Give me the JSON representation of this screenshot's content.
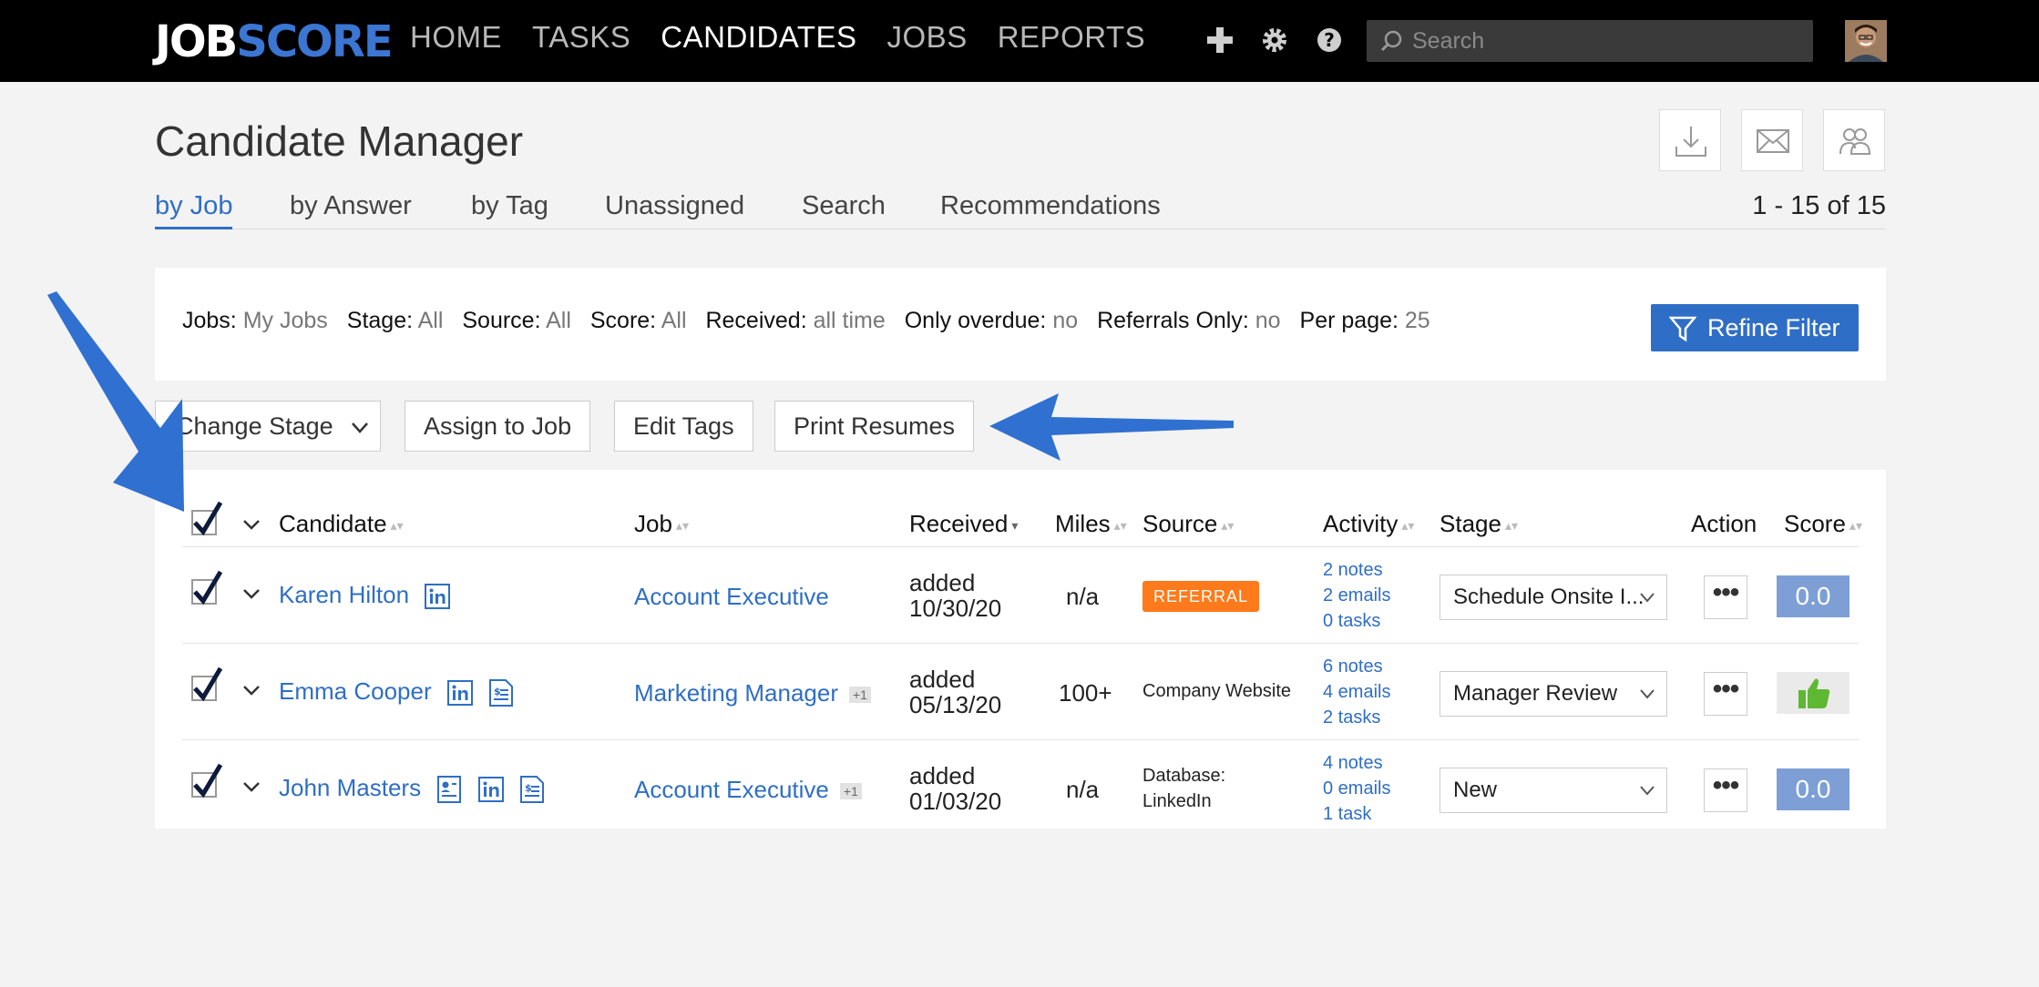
{
  "logo": {
    "part1": "JOB",
    "part2": "SCORE"
  },
  "nav": {
    "items": [
      {
        "label": "HOME",
        "active": false
      },
      {
        "label": "TASKS",
        "active": false
      },
      {
        "label": "CANDIDATES",
        "active": true
      },
      {
        "label": "JOBS",
        "active": false
      },
      {
        "label": "REPORTS",
        "active": false
      }
    ]
  },
  "topbar": {
    "search_placeholder": "Search",
    "icons": [
      "plus-icon",
      "gear-icon",
      "help-icon",
      "search-icon"
    ]
  },
  "page": {
    "title": "Candidate Manager",
    "count": "1 - 15 of 15",
    "header_icons": [
      "download-icon",
      "email-icon",
      "users-icon"
    ]
  },
  "tabs": [
    {
      "label": "by Job",
      "active": true
    },
    {
      "label": "by Answer",
      "active": false
    },
    {
      "label": "by Tag",
      "active": false
    },
    {
      "label": "Unassigned",
      "active": false
    },
    {
      "label": "Search",
      "active": false
    },
    {
      "label": "Recommendations",
      "active": false
    }
  ],
  "filters": [
    {
      "key": "Jobs:",
      "value": "My Jobs"
    },
    {
      "key": "Stage:",
      "value": "All"
    },
    {
      "key": "Source:",
      "value": "All"
    },
    {
      "key": "Score:",
      "value": "All"
    },
    {
      "key": "Received:",
      "value": "all time"
    },
    {
      "key": "Only overdue:",
      "value": "no"
    },
    {
      "key": "Referrals Only:",
      "value": "no"
    },
    {
      "key": "Per page:",
      "value": "25"
    }
  ],
  "refine_label": "Refine Filter",
  "actions": {
    "change_stage": "Change Stage",
    "assign_job": "Assign to Job",
    "edit_tags": "Edit Tags",
    "print_resumes": "Print Resumes"
  },
  "table": {
    "headers": {
      "candidate": "Candidate",
      "job": "Job",
      "received": "Received",
      "miles": "Miles",
      "source": "Source",
      "activity": "Activity",
      "stage": "Stage",
      "action": "Action",
      "score": "Score"
    },
    "rows": [
      {
        "name": "Karen Hilton",
        "icons": [
          "linkedin-icon"
        ],
        "job": "Account Executive",
        "job_extra": "",
        "received_1": "added",
        "received_2": "10/30/20",
        "miles": "n/a",
        "source": "REFERRAL",
        "source_is_badge": true,
        "source_2": "",
        "notes": "2 notes",
        "emails": "2 emails",
        "tasks": "0 tasks",
        "stage": "Schedule Onsite I...",
        "score": "0.0",
        "score_type": "number"
      },
      {
        "name": "Emma Cooper",
        "icons": [
          "linkedin-icon",
          "resume-icon"
        ],
        "job": "Marketing Manager",
        "job_extra": "+1",
        "received_1": "added",
        "received_2": "05/13/20",
        "miles": "100+",
        "source": "Company Website",
        "source_is_badge": false,
        "source_2": "",
        "notes": "6 notes",
        "emails": "4 emails",
        "tasks": "2 tasks",
        "stage": "Manager Review",
        "score": "",
        "score_type": "thumbs-up"
      },
      {
        "name": "John Masters",
        "icons": [
          "profile-card-icon",
          "linkedin-icon",
          "resume-icon"
        ],
        "job": "Account Executive",
        "job_extra": "+1",
        "received_1": "added",
        "received_2": "01/03/20",
        "miles": "n/a",
        "source": "Database:",
        "source_is_badge": false,
        "source_2": "LinkedIn",
        "notes": "4 notes",
        "emails": "0 emails",
        "tasks": "1 task",
        "stage": "New",
        "score": "0.0",
        "score_type": "number"
      }
    ]
  },
  "colors": {
    "accent": "#2f6ec6",
    "referral": "#ff7a1a",
    "score": "#7d9fd6",
    "thumb": "#5fb832",
    "arrow": "#3070d0"
  }
}
